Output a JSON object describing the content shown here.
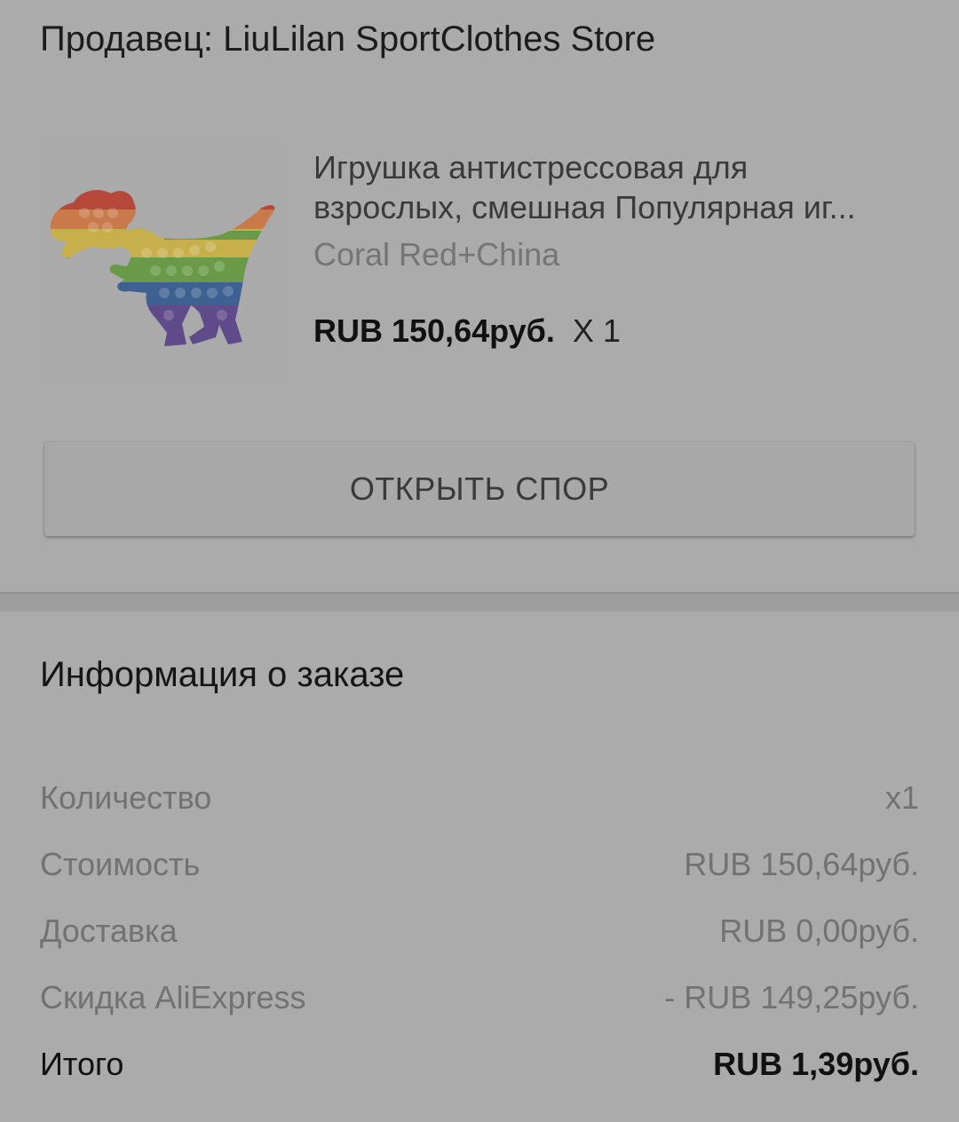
{
  "seller": "Продавец: LiuLilan SportClothes Store",
  "product": {
    "title_line1": "Игрушка антистрессовая для",
    "title_line2": "взрослых, смешная Популярная иг...",
    "variant": "Coral Red+China",
    "price": "RUB 150,64руб.",
    "quantity": "X 1",
    "image_icon": "rainbow-dinosaur-pop-it-image"
  },
  "dispute_button": "ОТКРЫТЬ СПОР",
  "order_info": {
    "title": "Информация о заказе",
    "rows": [
      {
        "label": "Количество",
        "value": "x1"
      },
      {
        "label": "Стоимость",
        "value": "RUB 150,64руб."
      },
      {
        "label": "Доставка",
        "value": "RUB 0,00руб."
      },
      {
        "label": "Скидка AliExpress",
        "value": "- RUB 149,25руб."
      }
    ],
    "total": {
      "label": "Итого",
      "value": "RUB 1,39руб."
    }
  },
  "colors": {
    "background": "#ababab",
    "divider": "#9e9e9e",
    "button": "#a8a8a8"
  }
}
